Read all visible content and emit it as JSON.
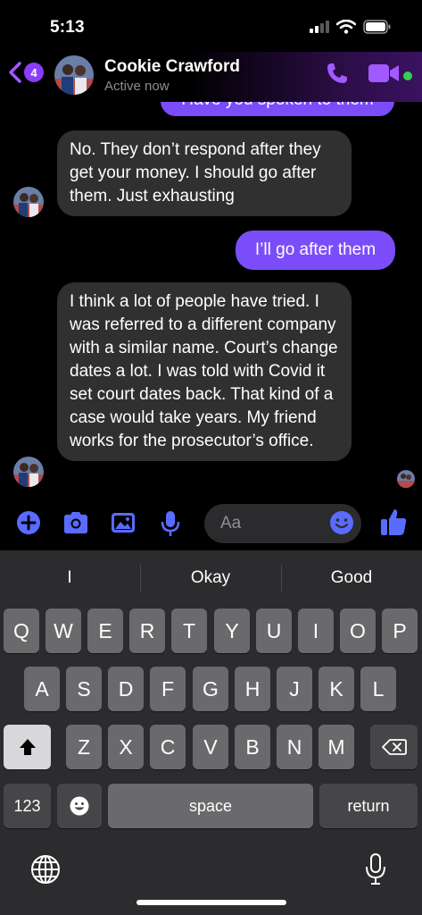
{
  "status_bar": {
    "time": "5:13",
    "icons": [
      "signal-icon",
      "wifi-icon",
      "battery-icon"
    ]
  },
  "header": {
    "back_badge": "4",
    "contact_name": "Cookie Crawford",
    "contact_status": "Active now",
    "icons": [
      "back-chevron-icon",
      "phone-icon",
      "video-camera-icon"
    ],
    "accent_color": "#8a3cff",
    "online_color": "#31d04d"
  },
  "messages": [
    {
      "direction": "out",
      "text": "Have you spoken to them"
    },
    {
      "direction": "in",
      "text": "No. They don’t respond after they get your money. I should go after them. Just exhausting"
    },
    {
      "direction": "out",
      "text": "I’ll go after them"
    },
    {
      "direction": "in",
      "text": "I think a lot of people have tried. I was referred to a different company with a similar name. Court’s change dates a lot. I was told with Covid it set court dates back. That kind of a case would take years. My friend works for the prosecutor’s office."
    }
  ],
  "composer": {
    "placeholder": "Aa",
    "icons": [
      "plus-icon",
      "camera-icon",
      "image-icon",
      "microphone-icon",
      "emoji-icon",
      "thumbs-up-icon"
    ]
  },
  "keyboard": {
    "suggestions": [
      "I",
      "Okay",
      "Good"
    ],
    "row1": [
      "Q",
      "W",
      "E",
      "R",
      "T",
      "Y",
      "U",
      "I",
      "O",
      "P"
    ],
    "row2": [
      "A",
      "S",
      "D",
      "F",
      "G",
      "H",
      "J",
      "K",
      "L"
    ],
    "row3": [
      "Z",
      "X",
      "C",
      "V",
      "B",
      "N",
      "M"
    ],
    "numbers_key": "123",
    "space_key": "space",
    "return_key": "return",
    "icons": [
      "shift-icon",
      "delete-icon",
      "emoji-key-icon",
      "globe-icon",
      "dictation-icon"
    ]
  }
}
